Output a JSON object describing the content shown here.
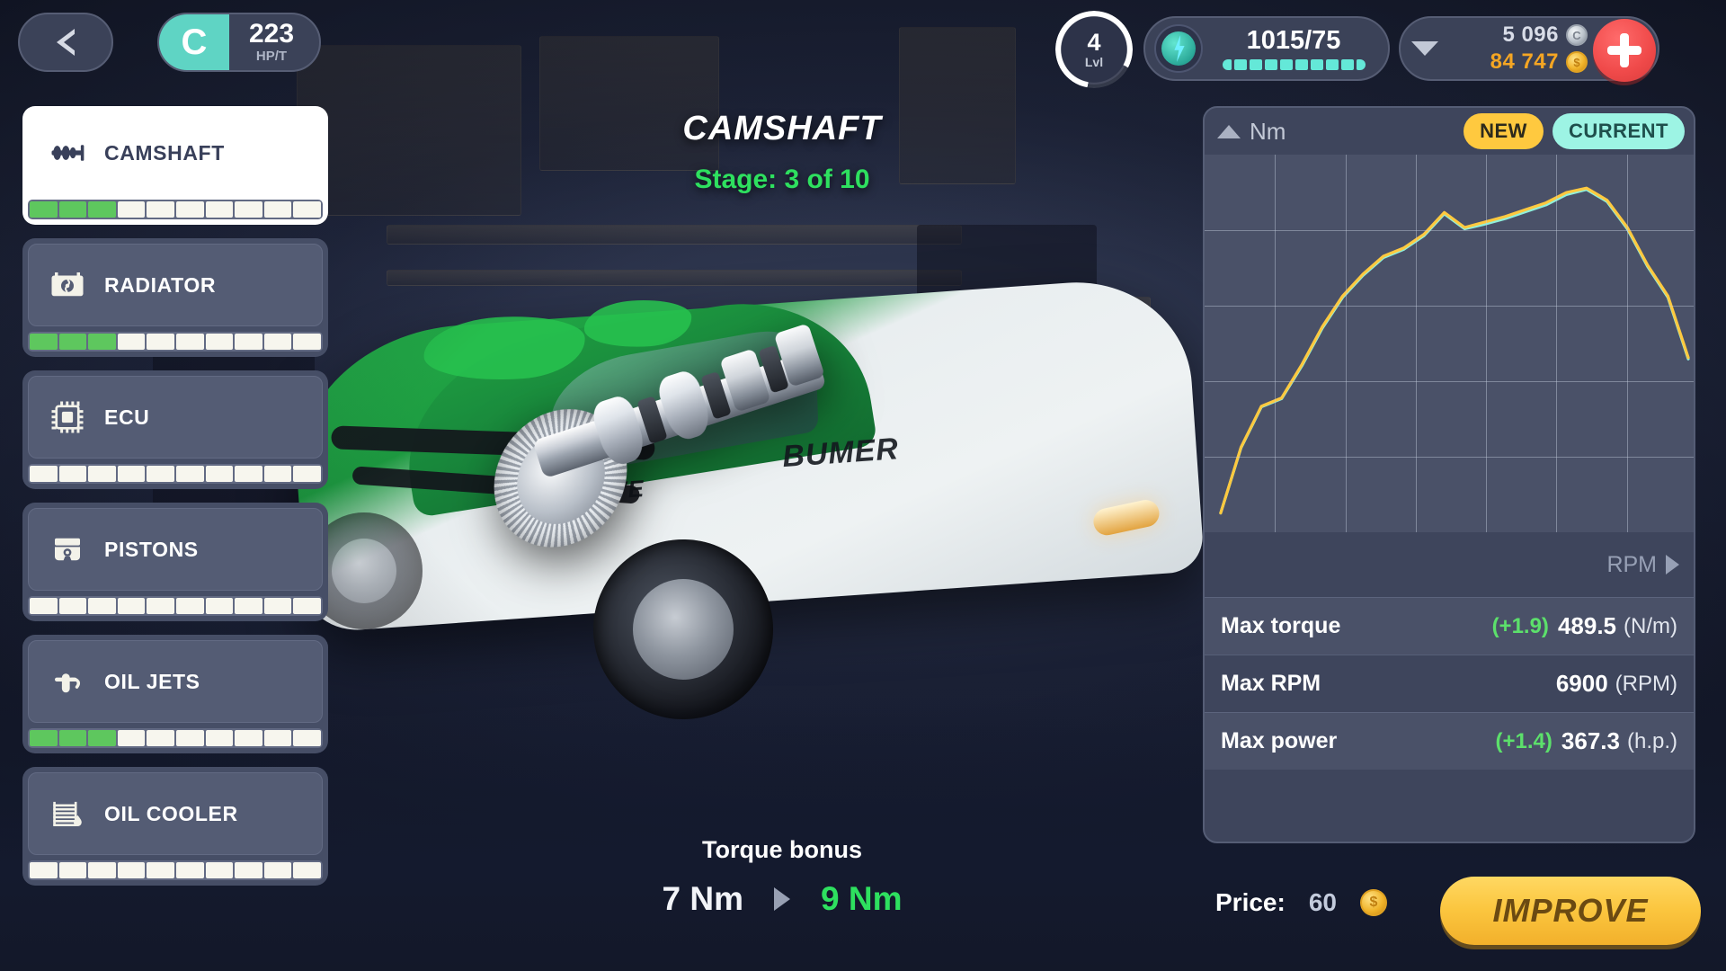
{
  "hud": {
    "back_icon": "chevron-left-icon",
    "rank_letter": "C",
    "rank_value": "223",
    "rank_unit": "HP/T",
    "level_value": "4",
    "level_label": "Lvl",
    "energy_value": "1015/75",
    "energy_icon": "lightning-bolt-icon",
    "energy_segments": 10,
    "silver_amount": "5 096",
    "gold_amount": "84 747",
    "silver_icon": "silver-coin-icon",
    "gold_icon": "gold-coin-icon",
    "add_icon": "plus-icon",
    "collapse_icon": "chevron-down-icon"
  },
  "parts": [
    {
      "label": "CAMSHAFT",
      "icon": "camshaft-icon",
      "filled": 3,
      "total": 10,
      "active": true
    },
    {
      "label": "RADIATOR",
      "icon": "radiator-icon",
      "filled": 3,
      "total": 10,
      "active": false
    },
    {
      "label": "ECU",
      "icon": "ecu-chip-icon",
      "filled": 0,
      "total": 10,
      "active": false
    },
    {
      "label": "PISTONS",
      "icon": "piston-icon",
      "filled": 0,
      "total": 10,
      "active": false
    },
    {
      "label": "OIL JETS",
      "icon": "oil-jet-icon",
      "filled": 3,
      "total": 10,
      "active": false
    },
    {
      "label": "OIL COOLER",
      "icon": "oil-cooler-icon",
      "filled": 0,
      "total": 10,
      "active": false
    }
  ],
  "center": {
    "title": "CAMSHAFT",
    "stage": "Stage: 3 of 10"
  },
  "bonus": {
    "title": "Torque bonus",
    "old_value": "7 Nm",
    "new_value": "9 Nm",
    "arrow_icon": "triangle-right-icon"
  },
  "panel": {
    "y_axis_label": "Nm",
    "y_axis_icon": "triangle-up-icon",
    "x_axis_label": "RPM",
    "x_axis_icon": "triangle-right-icon",
    "chip_new": "NEW",
    "chip_current": "CURRENT",
    "stats": [
      {
        "name": "Max torque",
        "delta": "(+1.9)",
        "value": "489.5",
        "unit": "(N/m)"
      },
      {
        "name": "Max RPM",
        "delta": "",
        "value": "6900",
        "unit": "(RPM)"
      },
      {
        "name": "Max power",
        "delta": "(+1.4)",
        "value": "367.3",
        "unit": "(h.p.)"
      }
    ]
  },
  "footer": {
    "price_label": "Price:",
    "price_value": "60",
    "price_icon": "gold-coin-icon",
    "improve_label": "IMPROVE"
  },
  "colors": {
    "accent_teal": "#5fd4c4",
    "curve_current": "#8ff0dc",
    "curve_new": "#ffc93f",
    "positive_green": "#2ee05f",
    "chip_new": "#ffc93f",
    "chip_current": "#9df4e4",
    "gold": "#f5a623",
    "add_red": "#f04a4a",
    "panel_bg": "#3e455c",
    "plot_bg": "#4a5168"
  },
  "chart_data": {
    "type": "line",
    "title": "",
    "xlabel": "RPM",
    "ylabel": "Nm",
    "grid": true,
    "legend": [
      "NEW",
      "CURRENT"
    ],
    "legend_position": "top-right",
    "xlim": [
      0,
      6900
    ],
    "ylim": [
      0,
      520
    ],
    "x_gridlines": 7,
    "y_gridlines": 5,
    "series": [
      {
        "name": "CURRENT",
        "color": "#8ff0dc",
        "x": [
          0,
          300,
          600,
          900,
          1200,
          1500,
          1800,
          2100,
          2400,
          2700,
          3000,
          3300,
          3600,
          3900,
          4200,
          4500,
          4800,
          5100,
          5400,
          5700,
          6000,
          6300,
          6600,
          6900
        ],
        "y": [
          15,
          110,
          170,
          182,
          230,
          285,
          330,
          362,
          388,
          400,
          420,
          452,
          430,
          437,
          445,
          455,
          465,
          480,
          487.6,
          470,
          430,
          375,
          330,
          240
        ]
      },
      {
        "name": "NEW",
        "color": "#ffc93f",
        "x": [
          0,
          300,
          600,
          900,
          1200,
          1500,
          1800,
          2100,
          2400,
          2700,
          3000,
          3300,
          3600,
          3900,
          4200,
          4500,
          4800,
          5100,
          5400,
          5700,
          6000,
          6300,
          6600,
          6900
        ],
        "y": [
          15,
          111,
          171,
          183,
          232,
          287,
          332,
          364,
          390,
          402,
          422,
          454,
          432,
          440,
          448,
          458,
          468,
          483,
          489.5,
          472,
          432,
          377,
          332,
          242
        ]
      }
    ]
  }
}
